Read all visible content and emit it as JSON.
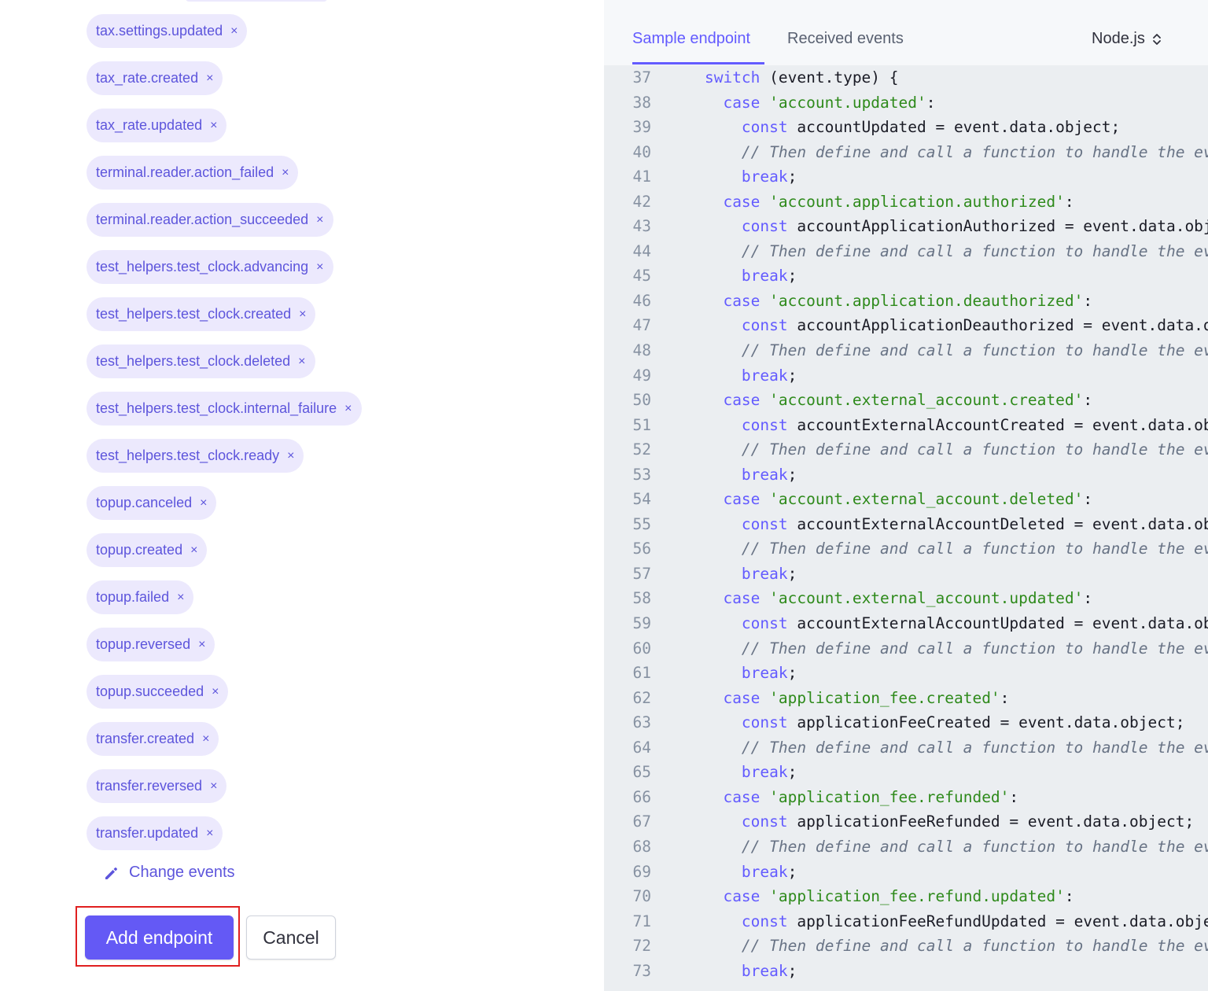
{
  "events": [
    "tax.settings.updated",
    "tax_rate.created",
    "tax_rate.updated",
    "terminal.reader.action_failed",
    "terminal.reader.action_succeeded",
    "test_helpers.test_clock.advancing",
    "test_helpers.test_clock.created",
    "test_helpers.test_clock.deleted",
    "test_helpers.test_clock.internal_failure",
    "test_helpers.test_clock.ready",
    "topup.canceled",
    "topup.created",
    "topup.failed",
    "topup.reversed",
    "topup.succeeded",
    "transfer.created",
    "transfer.reversed",
    "transfer.updated"
  ],
  "remove_glyph": "×",
  "change_events_label": "Change events",
  "add_endpoint_label": "Add endpoint",
  "cancel_label": "Cancel",
  "tabs": [
    "Sample endpoint",
    "Received events"
  ],
  "language": "Node.js",
  "colors": {
    "accent": "#635bff",
    "chip_bg": "#ece9fd",
    "keyword": "#635bff",
    "string": "#2e8a1b",
    "comment": "#687385",
    "focus_outline": "#e02020"
  },
  "code_lines": [
    {
      "n": "37",
      "t": [
        [
          "    ",
          ""
        ],
        [
          "switch",
          "kw"
        ],
        [
          " (event.type) {",
          ""
        ]
      ]
    },
    {
      "n": "38",
      "t": [
        [
          "      ",
          ""
        ],
        [
          "case",
          "kw"
        ],
        [
          " ",
          ""
        ],
        [
          "'account.updated'",
          "str"
        ],
        [
          ":",
          ""
        ]
      ]
    },
    {
      "n": "39",
      "t": [
        [
          "        ",
          ""
        ],
        [
          "const",
          "kw"
        ],
        [
          " accountUpdated = event.data.object;",
          ""
        ]
      ]
    },
    {
      "n": "40",
      "t": [
        [
          "        ",
          ""
        ],
        [
          "// Then define and call a function to handle the ev",
          "cm"
        ]
      ]
    },
    {
      "n": "41",
      "t": [
        [
          "        ",
          ""
        ],
        [
          "break",
          "kw"
        ],
        [
          ";",
          ""
        ]
      ]
    },
    {
      "n": "42",
      "t": [
        [
          "      ",
          ""
        ],
        [
          "case",
          "kw"
        ],
        [
          " ",
          ""
        ],
        [
          "'account.application.authorized'",
          "str"
        ],
        [
          ":",
          ""
        ]
      ]
    },
    {
      "n": "43",
      "t": [
        [
          "        ",
          ""
        ],
        [
          "const",
          "kw"
        ],
        [
          " accountApplicationAuthorized = event.data.obj",
          ""
        ]
      ]
    },
    {
      "n": "44",
      "t": [
        [
          "        ",
          ""
        ],
        [
          "// Then define and call a function to handle the ev",
          "cm"
        ]
      ]
    },
    {
      "n": "45",
      "t": [
        [
          "        ",
          ""
        ],
        [
          "break",
          "kw"
        ],
        [
          ";",
          ""
        ]
      ]
    },
    {
      "n": "46",
      "t": [
        [
          "      ",
          ""
        ],
        [
          "case",
          "kw"
        ],
        [
          " ",
          ""
        ],
        [
          "'account.application.deauthorized'",
          "str"
        ],
        [
          ":",
          ""
        ]
      ]
    },
    {
      "n": "47",
      "t": [
        [
          "        ",
          ""
        ],
        [
          "const",
          "kw"
        ],
        [
          " accountApplicationDeauthorized = event.data.o",
          ""
        ]
      ]
    },
    {
      "n": "48",
      "t": [
        [
          "        ",
          ""
        ],
        [
          "// Then define and call a function to handle the ev",
          "cm"
        ]
      ]
    },
    {
      "n": "49",
      "t": [
        [
          "        ",
          ""
        ],
        [
          "break",
          "kw"
        ],
        [
          ";",
          ""
        ]
      ]
    },
    {
      "n": "50",
      "t": [
        [
          "      ",
          ""
        ],
        [
          "case",
          "kw"
        ],
        [
          " ",
          ""
        ],
        [
          "'account.external_account.created'",
          "str"
        ],
        [
          ":",
          ""
        ]
      ]
    },
    {
      "n": "51",
      "t": [
        [
          "        ",
          ""
        ],
        [
          "const",
          "kw"
        ],
        [
          " accountExternalAccountCreated = event.data.ob",
          ""
        ]
      ]
    },
    {
      "n": "52",
      "t": [
        [
          "        ",
          ""
        ],
        [
          "// Then define and call a function to handle the ev",
          "cm"
        ]
      ]
    },
    {
      "n": "53",
      "t": [
        [
          "        ",
          ""
        ],
        [
          "break",
          "kw"
        ],
        [
          ";",
          ""
        ]
      ]
    },
    {
      "n": "54",
      "t": [
        [
          "      ",
          ""
        ],
        [
          "case",
          "kw"
        ],
        [
          " ",
          ""
        ],
        [
          "'account.external_account.deleted'",
          "str"
        ],
        [
          ":",
          ""
        ]
      ]
    },
    {
      "n": "55",
      "t": [
        [
          "        ",
          ""
        ],
        [
          "const",
          "kw"
        ],
        [
          " accountExternalAccountDeleted = event.data.ob",
          ""
        ]
      ]
    },
    {
      "n": "56",
      "t": [
        [
          "        ",
          ""
        ],
        [
          "// Then define and call a function to handle the ev",
          "cm"
        ]
      ]
    },
    {
      "n": "57",
      "t": [
        [
          "        ",
          ""
        ],
        [
          "break",
          "kw"
        ],
        [
          ";",
          ""
        ]
      ]
    },
    {
      "n": "58",
      "t": [
        [
          "      ",
          ""
        ],
        [
          "case",
          "kw"
        ],
        [
          " ",
          ""
        ],
        [
          "'account.external_account.updated'",
          "str"
        ],
        [
          ":",
          ""
        ]
      ]
    },
    {
      "n": "59",
      "t": [
        [
          "        ",
          ""
        ],
        [
          "const",
          "kw"
        ],
        [
          " accountExternalAccountUpdated = event.data.ob",
          ""
        ]
      ]
    },
    {
      "n": "60",
      "t": [
        [
          "        ",
          ""
        ],
        [
          "// Then define and call a function to handle the ev",
          "cm"
        ]
      ]
    },
    {
      "n": "61",
      "t": [
        [
          "        ",
          ""
        ],
        [
          "break",
          "kw"
        ],
        [
          ";",
          ""
        ]
      ]
    },
    {
      "n": "62",
      "t": [
        [
          "      ",
          ""
        ],
        [
          "case",
          "kw"
        ],
        [
          " ",
          ""
        ],
        [
          "'application_fee.created'",
          "str"
        ],
        [
          ":",
          ""
        ]
      ]
    },
    {
      "n": "63",
      "t": [
        [
          "        ",
          ""
        ],
        [
          "const",
          "kw"
        ],
        [
          " applicationFeeCreated = event.data.object;",
          ""
        ]
      ]
    },
    {
      "n": "64",
      "t": [
        [
          "        ",
          ""
        ],
        [
          "// Then define and call a function to handle the ev",
          "cm"
        ]
      ]
    },
    {
      "n": "65",
      "t": [
        [
          "        ",
          ""
        ],
        [
          "break",
          "kw"
        ],
        [
          ";",
          ""
        ]
      ]
    },
    {
      "n": "66",
      "t": [
        [
          "      ",
          ""
        ],
        [
          "case",
          "kw"
        ],
        [
          " ",
          ""
        ],
        [
          "'application_fee.refunded'",
          "str"
        ],
        [
          ":",
          ""
        ]
      ]
    },
    {
      "n": "67",
      "t": [
        [
          "        ",
          ""
        ],
        [
          "const",
          "kw"
        ],
        [
          " applicationFeeRefunded = event.data.object;",
          ""
        ]
      ]
    },
    {
      "n": "68",
      "t": [
        [
          "        ",
          ""
        ],
        [
          "// Then define and call a function to handle the ev",
          "cm"
        ]
      ]
    },
    {
      "n": "69",
      "t": [
        [
          "        ",
          ""
        ],
        [
          "break",
          "kw"
        ],
        [
          ";",
          ""
        ]
      ]
    },
    {
      "n": "70",
      "t": [
        [
          "      ",
          ""
        ],
        [
          "case",
          "kw"
        ],
        [
          " ",
          ""
        ],
        [
          "'application_fee.refund.updated'",
          "str"
        ],
        [
          ":",
          ""
        ]
      ]
    },
    {
      "n": "71",
      "t": [
        [
          "        ",
          ""
        ],
        [
          "const",
          "kw"
        ],
        [
          " applicationFeeRefundUpdated = event.data.obje",
          ""
        ]
      ]
    },
    {
      "n": "72",
      "t": [
        [
          "        ",
          ""
        ],
        [
          "// Then define and call a function to handle the ev",
          "cm"
        ]
      ]
    },
    {
      "n": "73",
      "t": [
        [
          "        ",
          ""
        ],
        [
          "break",
          "kw"
        ],
        [
          ";",
          ""
        ]
      ]
    }
  ]
}
